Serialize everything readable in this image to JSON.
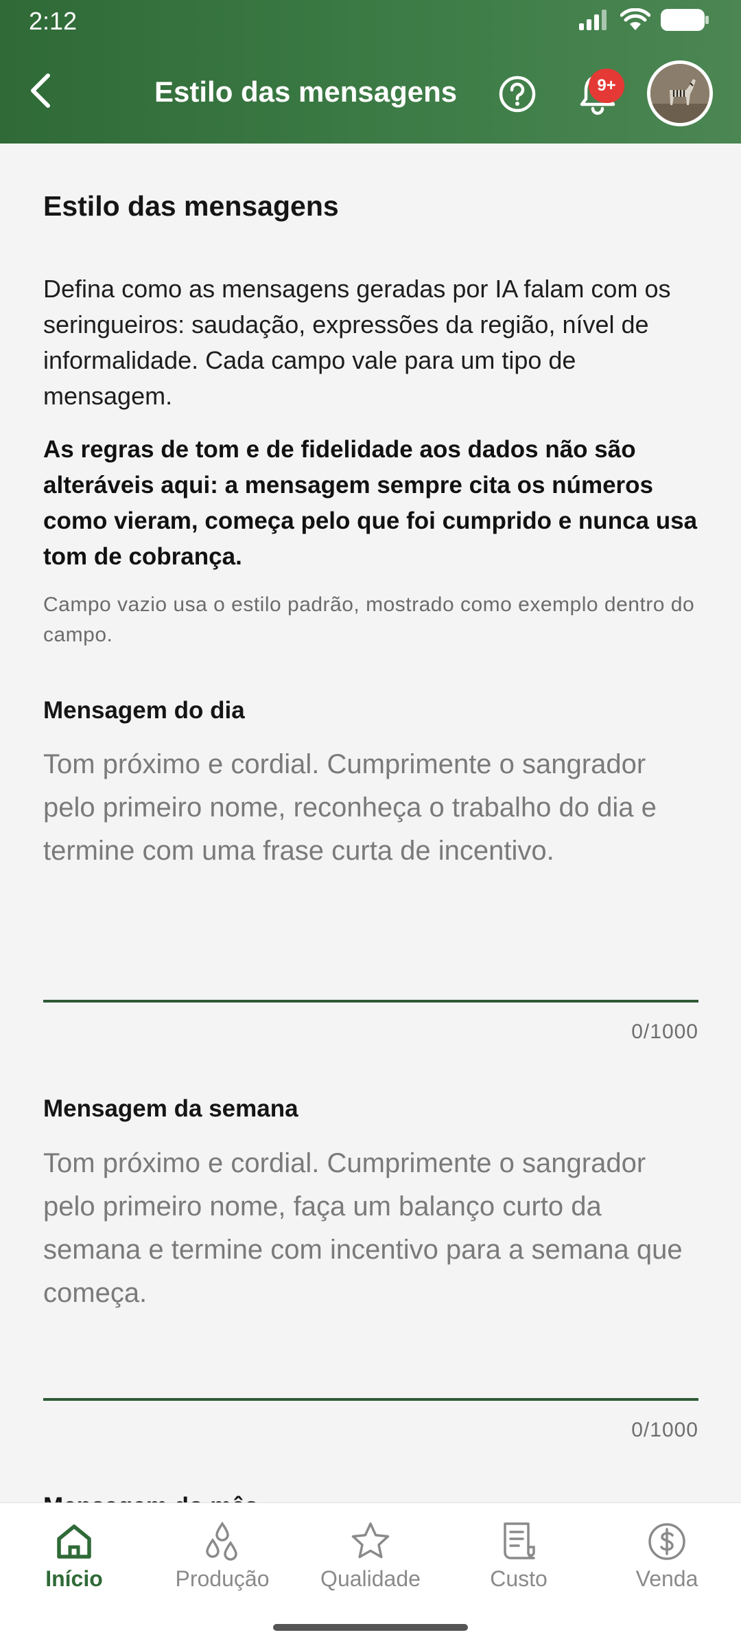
{
  "status_bar": {
    "time": "2:12"
  },
  "header": {
    "title": "Estilo das mensagens",
    "notification_count": "9+"
  },
  "main": {
    "heading": "Estilo das mensagens",
    "description": "Defina como as mensagens geradas por IA falam com os seringueiros: saudação, expressões da região, nível de informalidade. Cada campo vale para um tipo de mensagem.",
    "rules_notice": "As regras de tom e de fidelidade aos dados não são alteráveis aqui: a mensagem sempre cita os números como vieram, começa pelo que foi cumprido e nunca usa tom de cobrança.",
    "hint": "Campo vazio usa o estilo padrão, mostrado como exemplo dentro do campo.",
    "fields": [
      {
        "label": "Mensagem do dia",
        "value": "",
        "placeholder": "Tom próximo e cordial. Cumprimente o sangrador pelo primeiro nome, reconheça o trabalho do dia e termine com uma frase curta de incentivo.",
        "counter": "0/1000"
      },
      {
        "label": "Mensagem da semana",
        "value": "",
        "placeholder": "Tom próximo e cordial. Cumprimente o sangrador pelo primeiro nome, faça um balanço curto da semana e termine com incentivo para a semana que começa.",
        "counter": "0/1000"
      }
    ],
    "next_field_label_partial": "Mensagem do mês"
  },
  "bottom_nav": {
    "items": [
      {
        "label": "Início",
        "icon": "home-icon",
        "active": true
      },
      {
        "label": "Produção",
        "icon": "drops-icon",
        "active": false
      },
      {
        "label": "Qualidade",
        "icon": "star-icon",
        "active": false
      },
      {
        "label": "Custo",
        "icon": "receipt-icon",
        "active": false
      },
      {
        "label": "Venda",
        "icon": "dollar-icon",
        "active": false
      }
    ]
  },
  "colors": {
    "header_green": "#3d7c46",
    "accent_green": "#2f6a37",
    "badge_red": "#e53935",
    "background": "#f4f4f4"
  }
}
